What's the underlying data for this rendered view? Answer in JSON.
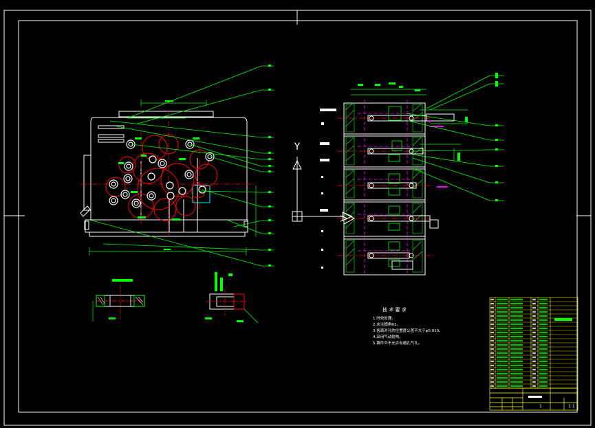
{
  "sheet": {
    "background": "#000000",
    "line_color": "#ffffff",
    "colors": {
      "outline": "#ffffff",
      "leader": "#00ff00",
      "feature": "#ff0000",
      "centerline": "#ff0000",
      "hidden": "#ff00ff",
      "title_block": "#ffff00",
      "accent_box": "#00ffff"
    }
  },
  "axis_marker": {
    "y_label": "Y",
    "icon": "ucs-axis-icon"
  },
  "tech_requirements": {
    "title": "技 术 要 求",
    "items": [
      "1.时效处理。",
      "2.未注圆角R2。",
      "3.各面对孔的位置度公差不大于φ0.010。",
      "4.采用气动结构。",
      "5.铸件中不允许有缩孔气孔。"
    ]
  },
  "title_block": {
    "sheet_no": "1",
    "scale": "1:1"
  }
}
